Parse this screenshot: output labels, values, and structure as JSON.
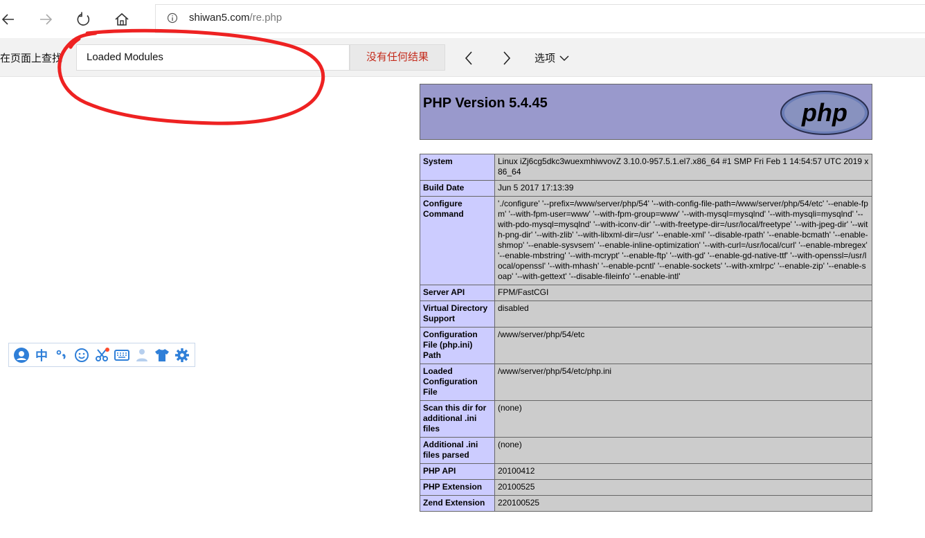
{
  "browser": {
    "url_host": "shiwan5.com",
    "url_path": "/re.php",
    "icons": {
      "back": "back-arrow-icon",
      "forward": "forward-arrow-icon",
      "refresh": "refresh-icon",
      "home": "home-icon",
      "info": "info-icon"
    }
  },
  "findbar": {
    "label": "在页面上查找",
    "query": "Loaded Modules",
    "result": "没有任何结果",
    "options_label": "选项",
    "result_color": "#c42b1c"
  },
  "ime_toolbar": {
    "items": [
      "user-icon",
      "中",
      "punctuation-icon",
      "emoji-icon",
      "scissors-icon",
      "keyboard-icon",
      "person-icon",
      "skin-icon",
      "settings-icon"
    ],
    "mode_label": "中"
  },
  "phpinfo": {
    "title": "PHP Version 5.4.45",
    "logo_text": "php",
    "rows": [
      {
        "key": "System",
        "value": "Linux iZj6cg5dkc3wuexmhiwvovZ 3.10.0-957.5.1.el7.x86_64 #1 SMP Fri Feb 1 14:54:57 UTC 2019 x86_64"
      },
      {
        "key": "Build Date",
        "value": "Jun 5 2017 17:13:39"
      },
      {
        "key": "Configure Command",
        "value": "'./configure' '--prefix=/www/server/php/54' '--with-config-file-path=/www/server/php/54/etc' '--enable-fpm' '--with-fpm-user=www' '--with-fpm-group=www' '--with-mysql=mysqlnd' '--with-mysqli=mysqlnd' '--with-pdo-mysql=mysqlnd' '--with-iconv-dir' '--with-freetype-dir=/usr/local/freetype' '--with-jpeg-dir' '--with-png-dir' '--with-zlib' '--with-libxml-dir=/usr' '--enable-xml' '--disable-rpath' '--enable-bcmath' '--enable-shmop' '--enable-sysvsem' '--enable-inline-optimization' '--with-curl=/usr/local/curl' '--enable-mbregex' '--enable-mbstring' '--with-mcrypt' '--enable-ftp' '--with-gd' '--enable-gd-native-ttf' '--with-openssl=/usr/local/openssl' '--with-mhash' '--enable-pcntl' '--enable-sockets' '--with-xmlrpc' '--enable-zip' '--enable-soap' '--with-gettext' '--disable-fileinfo' '--enable-intl'"
      },
      {
        "key": "Server API",
        "value": "FPM/FastCGI"
      },
      {
        "key": "Virtual Directory Support",
        "value": "disabled"
      },
      {
        "key": "Configuration File (php.ini) Path",
        "value": "/www/server/php/54/etc"
      },
      {
        "key": "Loaded Configuration File",
        "value": "/www/server/php/54/etc/php.ini"
      },
      {
        "key": "Scan this dir for additional .ini files",
        "value": "(none)"
      },
      {
        "key": "Additional .ini files parsed",
        "value": "(none)"
      },
      {
        "key": "PHP API",
        "value": "20100412"
      },
      {
        "key": "PHP Extension",
        "value": "20100525"
      },
      {
        "key": "Zend Extension",
        "value": "220100525"
      }
    ]
  },
  "colors": {
    "header_bg": "#9999cc",
    "key_bg": "#ccccff",
    "value_bg": "#cccccc",
    "annotation": "#ee2222"
  }
}
